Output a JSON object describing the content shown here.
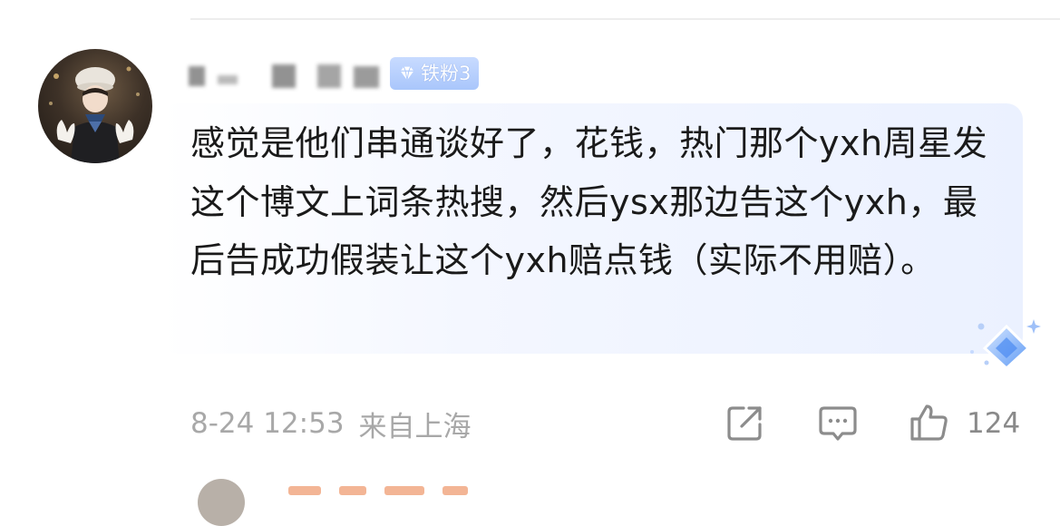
{
  "comment": {
    "username": "Z___________________",
    "fan_badge": {
      "label": "铁粉3",
      "icon": "diamond-icon"
    },
    "text": "感觉是他们串通谈好了，花钱，热门那个yxh周星发这个博文上词条热搜，然后ysx那边告这个yxh，最后告成功假装让这个yxh赔点钱（实际不用赔）。",
    "time": "8-24 12:53",
    "location": "来自上海",
    "like_count": "124"
  },
  "actions": {
    "share_icon": "share-icon",
    "comment_icon": "comment-icon",
    "like_icon": "thumbs-up-icon"
  },
  "colors": {
    "bubble_bg": "#eef3ff",
    "badge_bg": "#b5cdfb",
    "meta_text": "#a8a8a8",
    "icon_stroke": "#8c8c8c"
  }
}
